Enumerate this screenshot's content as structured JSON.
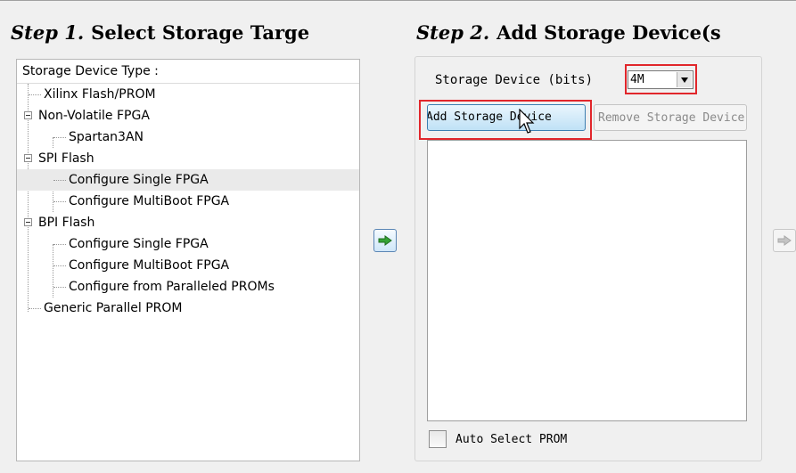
{
  "step1": {
    "label": "Step 1.",
    "title": "Select Storage Targe"
  },
  "step2": {
    "label": "Step 2.",
    "title": "Add Storage Device(s"
  },
  "tree": {
    "header": "Storage Device Type :",
    "items": [
      {
        "label": "Xilinx Flash/PROM"
      },
      {
        "label": "Non-Volatile FPGA"
      },
      {
        "label": "Spartan3AN"
      },
      {
        "label": "SPI Flash"
      },
      {
        "label": "Configure Single FPGA",
        "selected": true
      },
      {
        "label": "Configure MultiBoot FPGA"
      },
      {
        "label": "BPI Flash"
      },
      {
        "label": "Configure Single FPGA"
      },
      {
        "label": "Configure MultiBoot FPGA"
      },
      {
        "label": "Configure from Paralleled PROMs"
      },
      {
        "label": "Generic Parallel PROM"
      }
    ]
  },
  "storage": {
    "size_label": "Storage Device (bits)",
    "size_value": "4M",
    "add_button": "Add Storage Device",
    "remove_button": "Remove Storage Device",
    "auto_select_label": "Auto Select PROM",
    "auto_select_checked": false
  },
  "icons": {
    "add_arrow": "arrow-right-green-icon",
    "next_arrow": "arrow-right-gray-icon",
    "dropdown": "triangle-down-icon",
    "cursor": "mouse-pointer-icon"
  },
  "colors": {
    "highlight": "#e1262b",
    "arrow_green": "#2ea02e"
  }
}
